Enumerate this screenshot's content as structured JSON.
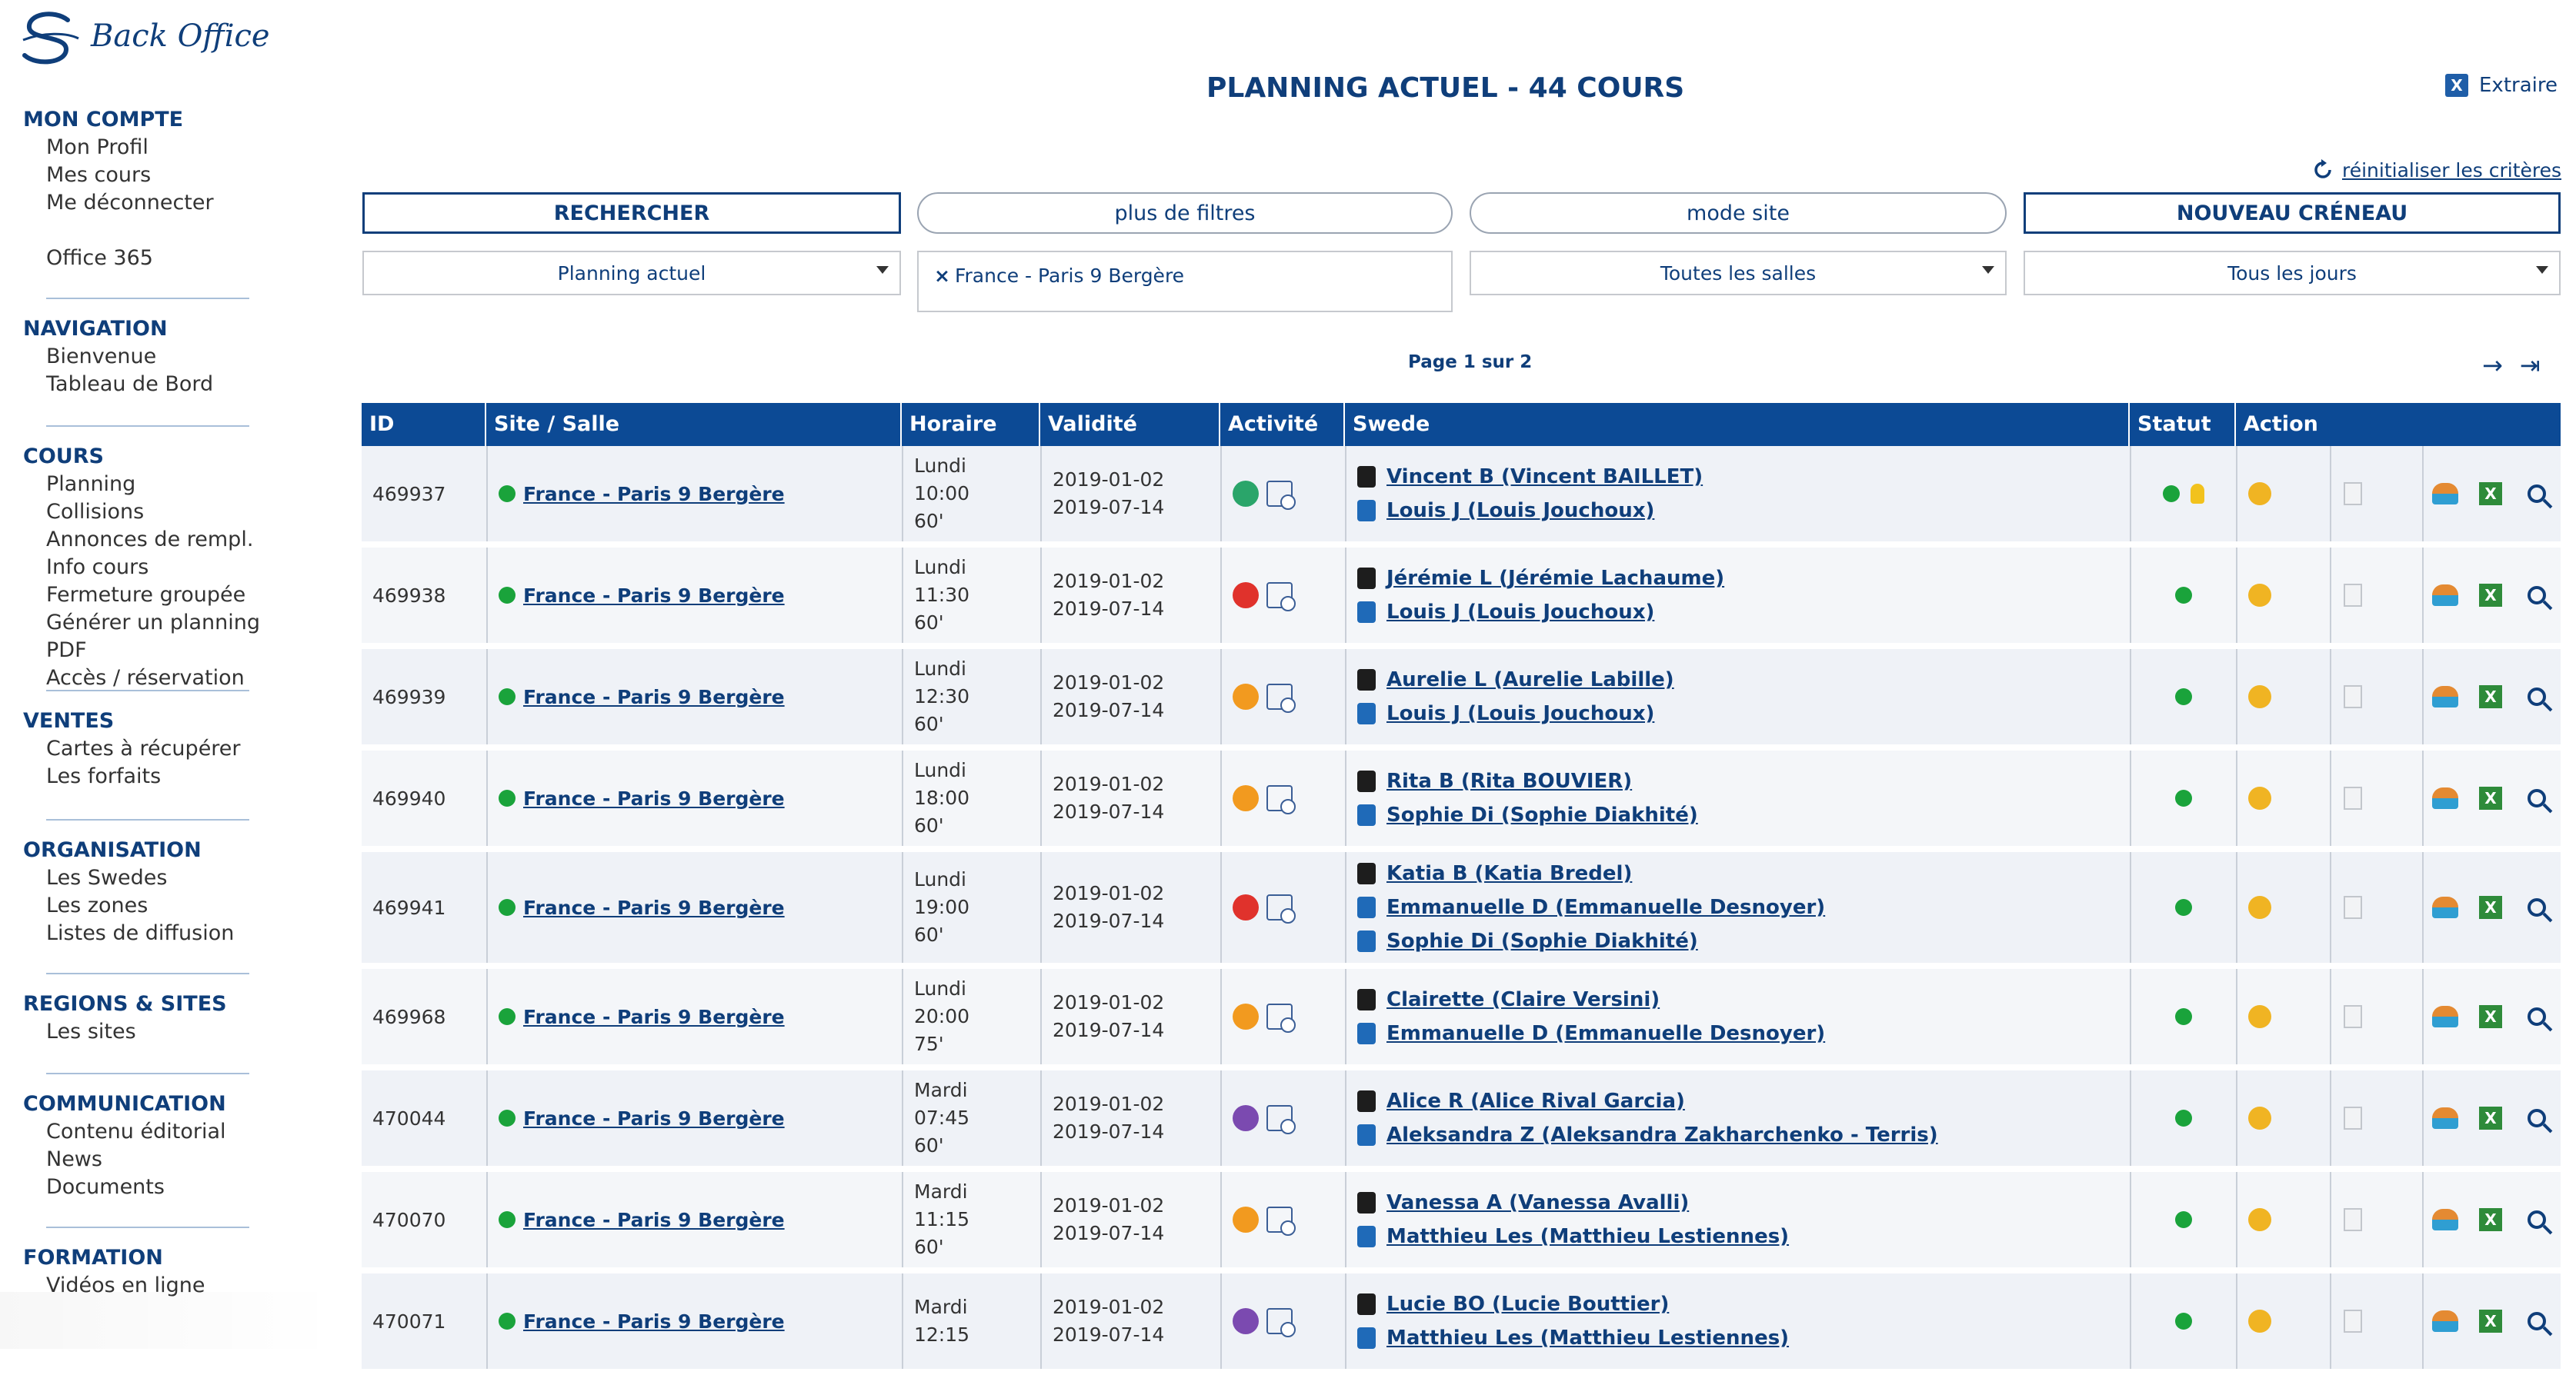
{
  "app": {
    "logo_text": "Back Office"
  },
  "sidebar": {
    "groups": [
      {
        "title": "MON COMPTE",
        "items": [
          "Mon Profil",
          "Mes cours",
          "Me déconnecter",
          "",
          "Office 365"
        ]
      },
      {
        "title": "NAVIGATION",
        "items": [
          "Bienvenue",
          "Tableau de Bord"
        ]
      },
      {
        "title": "COURS",
        "items": [
          "Planning",
          "Collisions",
          "Annonces de rempl.",
          "Info cours",
          "Fermeture groupée",
          "Générer un planning PDF",
          "Accès / réservation"
        ]
      },
      {
        "title": "VENTES",
        "items": [
          "Cartes à récupérer",
          "Les forfaits"
        ]
      },
      {
        "title": "ORGANISATION",
        "items": [
          "Les Swedes",
          "Les zones",
          "Listes de diffusion"
        ]
      },
      {
        "title": "REGIONS & SITES",
        "items": [
          "Les sites"
        ]
      },
      {
        "title": "COMMUNICATION",
        "items": [
          "Contenu éditorial",
          "News",
          "Documents"
        ]
      },
      {
        "title": "FORMATION",
        "items": [
          "Vidéos en ligne"
        ]
      }
    ]
  },
  "header": {
    "title": "PLANNING ACTUEL - 44 COURS",
    "export_label": "Extraire",
    "reset_label": "réinitialiser les critères"
  },
  "toolbar": {
    "search_label": "RECHERCHER",
    "more_filters_label": "plus de filtres",
    "site_mode_label": "mode site",
    "new_slot_label": "NOUVEAU CRÉNEAU"
  },
  "filters": {
    "planning": "Planning actuel",
    "site_tag": "France - Paris 9 Bergère",
    "rooms": "Toutes les salles",
    "days": "Tous les jours"
  },
  "pager": {
    "label": "Page 1 sur 2"
  },
  "table": {
    "columns": [
      "ID",
      "Site / Salle",
      "Horaire",
      "Validité",
      "Activité",
      "Swede",
      "Statut",
      "Action"
    ],
    "rows": [
      {
        "id": "469937",
        "site": "France - Paris 9 Bergère",
        "day": "Lundi",
        "time": "10:00",
        "dur": "60'",
        "from": "2019-01-02",
        "to": "2019-07-14",
        "activity_color": "#2aa56a",
        "swedes": [
          "Vincent B (Vincent BAILLET)",
          "Louis J (Louis Jouchoux)"
        ],
        "bulb": true
      },
      {
        "id": "469938",
        "site": "France - Paris 9 Bergère",
        "day": "Lundi",
        "time": "11:30",
        "dur": "60'",
        "from": "2019-01-02",
        "to": "2019-07-14",
        "activity_color": "#e0322c",
        "swedes": [
          "Jérémie L (Jérémie Lachaume)",
          "Louis J (Louis Jouchoux)"
        ],
        "bulb": false
      },
      {
        "id": "469939",
        "site": "France - Paris 9 Bergère",
        "day": "Lundi",
        "time": "12:30",
        "dur": "60'",
        "from": "2019-01-02",
        "to": "2019-07-14",
        "activity_color": "#f29a1f",
        "swedes": [
          "Aurelie L (Aurelie Labille)",
          "Louis J (Louis Jouchoux)"
        ],
        "bulb": false
      },
      {
        "id": "469940",
        "site": "France - Paris 9 Bergère",
        "day": "Lundi",
        "time": "18:00",
        "dur": "60'",
        "from": "2019-01-02",
        "to": "2019-07-14",
        "activity_color": "#f29a1f",
        "swedes": [
          "Rita B (Rita BOUVIER)",
          "Sophie Di (Sophie Diakhité)"
        ],
        "bulb": false
      },
      {
        "id": "469941",
        "site": "France - Paris 9 Bergère",
        "day": "Lundi",
        "time": "19:00",
        "dur": "60'",
        "from": "2019-01-02",
        "to": "2019-07-14",
        "activity_color": "#e0322c",
        "swedes": [
          "Katia B (Katia Bredel)",
          "Emmanuelle D (Emmanuelle Desnoyer)",
          "Sophie Di (Sophie Diakhité)"
        ],
        "bulb": false
      },
      {
        "id": "469968",
        "site": "France - Paris 9 Bergère",
        "day": "Lundi",
        "time": "20:00",
        "dur": "75'",
        "from": "2019-01-02",
        "to": "2019-07-14",
        "activity_color": "#f29a1f",
        "swedes": [
          "Clairette (Claire Versini)",
          "Emmanuelle D (Emmanuelle Desnoyer)"
        ],
        "bulb": false
      },
      {
        "id": "470044",
        "site": "France - Paris 9 Bergère",
        "day": "Mardi",
        "time": "07:45",
        "dur": "60'",
        "from": "2019-01-02",
        "to": "2019-07-14",
        "activity_color": "#7b4ab0",
        "swedes": [
          "Alice R (Alice Rival Garcia)",
          "Aleksandra Z (Aleksandra Zakharchenko - Terris)"
        ],
        "bulb": false
      },
      {
        "id": "470070",
        "site": "France - Paris 9 Bergère",
        "day": "Mardi",
        "time": "11:15",
        "dur": "60'",
        "from": "2019-01-02",
        "to": "2019-07-14",
        "activity_color": "#f29a1f",
        "swedes": [
          "Vanessa A (Vanessa Avalli)",
          "Matthieu Les (Matthieu Lestiennes)"
        ],
        "bulb": false
      },
      {
        "id": "470071",
        "site": "France - Paris 9 Bergère",
        "day": "Mardi",
        "time": "12:15",
        "dur": "",
        "from": "2019-01-02",
        "to": "2019-07-14",
        "activity_color": "#7b4ab0",
        "swedes": [
          "Lucie BO (Lucie Bouttier)",
          "Matthieu Les (Matthieu Lestiennes)"
        ],
        "bulb": false
      }
    ]
  }
}
